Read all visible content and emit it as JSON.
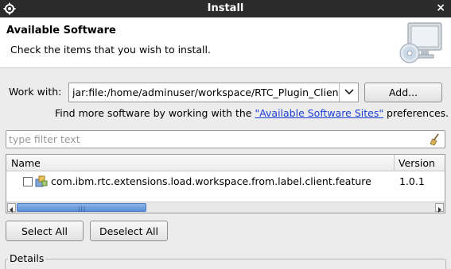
{
  "window": {
    "title": "Install",
    "close_label": "×"
  },
  "banner": {
    "heading": "Available Software",
    "description": "Check the items that you wish to install."
  },
  "work_with": {
    "label": "Work with:",
    "value": "jar:file:/home/adminuser/workspace/RTC_Plugin_Clien",
    "add_label": "Add..."
  },
  "find_more": {
    "prefix": "Find more software by working with the ",
    "link": "\"Available Software Sites\"",
    "suffix": " preferences."
  },
  "filter": {
    "placeholder": "type filter text",
    "value": ""
  },
  "table": {
    "columns": {
      "name": "Name",
      "version": "Version"
    },
    "rows": [
      {
        "name": "com.ibm.rtc.extensions.load.workspace.from.label.client.feature",
        "version": "1.0.1",
        "checked": false
      }
    ],
    "scroll_grip": "|||"
  },
  "buttons": {
    "select_all": "Select All",
    "deselect_all": "Deselect All"
  },
  "details": {
    "label": "Details"
  },
  "colors": {
    "titlebar": "#2b2b2b",
    "link": "#1a3ed6",
    "scroll_thumb": "#5a8fd6"
  }
}
